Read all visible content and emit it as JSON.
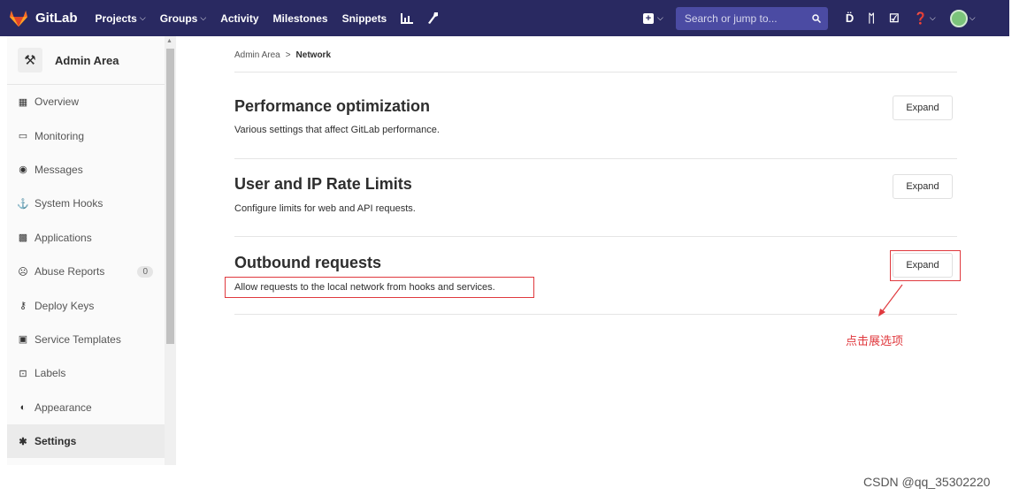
{
  "navbar": {
    "brand": "GitLab",
    "items": [
      {
        "label": "Projects",
        "dropdown": true
      },
      {
        "label": "Groups",
        "dropdown": true
      },
      {
        "label": "Activity",
        "dropdown": false
      },
      {
        "label": "Milestones",
        "dropdown": false
      },
      {
        "label": "Snippets",
        "dropdown": false
      }
    ],
    "search_placeholder": "Search or jump to...",
    "colors": {
      "bg": "#292961",
      "search_bg": "#4b4ba3"
    }
  },
  "sidebar": {
    "title": "Admin Area",
    "items": [
      {
        "label": "Overview",
        "icon": "grid-icon"
      },
      {
        "label": "Monitoring",
        "icon": "monitor-icon"
      },
      {
        "label": "Messages",
        "icon": "broadcast-icon"
      },
      {
        "label": "System Hooks",
        "icon": "hook-icon"
      },
      {
        "label": "Applications",
        "icon": "applications-icon"
      },
      {
        "label": "Abuse Reports",
        "icon": "abuse-icon",
        "badge": "0"
      },
      {
        "label": "Deploy Keys",
        "icon": "key-icon"
      },
      {
        "label": "Service Templates",
        "icon": "template-icon"
      },
      {
        "label": "Labels",
        "icon": "label-icon"
      },
      {
        "label": "Appearance",
        "icon": "palette-icon"
      },
      {
        "label": "Settings",
        "icon": "settings-icon",
        "active": true
      }
    ]
  },
  "breadcrumb": {
    "parent": "Admin Area",
    "separator": ">",
    "current": "Network"
  },
  "sections": [
    {
      "title": "Performance optimization",
      "description": "Various settings that affect GitLab performance.",
      "button": "Expand"
    },
    {
      "title": "User and IP Rate Limits",
      "description": "Configure limits for web and API requests.",
      "button": "Expand"
    },
    {
      "title": "Outbound requests",
      "description": "Allow requests to the local network from hooks and services.",
      "button": "Expand"
    }
  ],
  "annotation": {
    "note": "点击展选项",
    "color": "#e0393e"
  },
  "watermark": "CSDN @qq_35302220"
}
